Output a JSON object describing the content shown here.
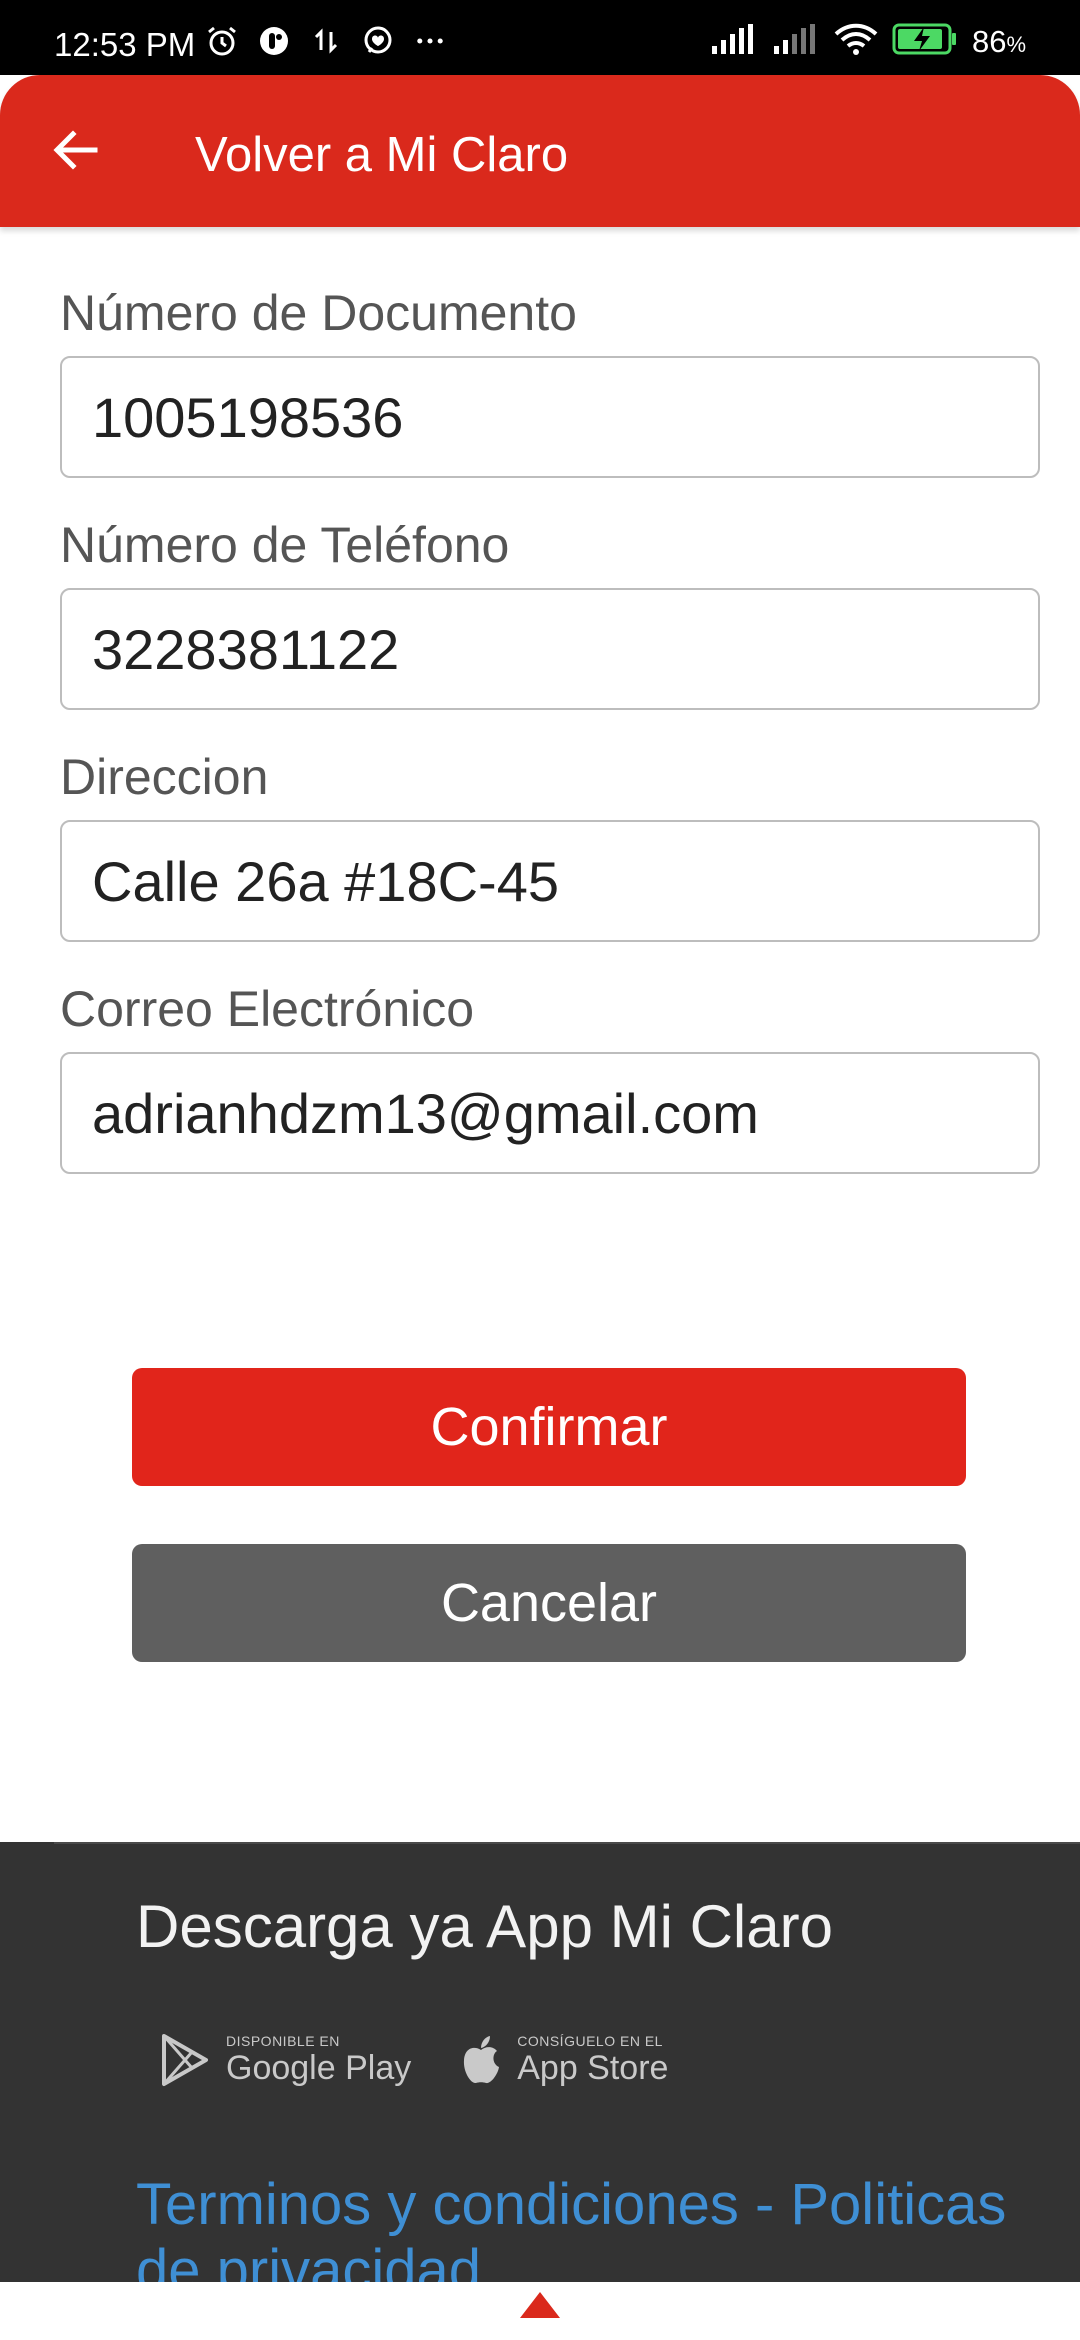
{
  "status_bar": {
    "time": "12:53 PM",
    "battery": "86",
    "battery_unit": "%",
    "icons": [
      "alarm-icon",
      "messenger-icon",
      "data-transfer-icon",
      "chat-icon",
      "more-dots-icon",
      "signal-icon",
      "signal-icon",
      "wifi-icon",
      "battery-charging-icon"
    ]
  },
  "app_bar": {
    "title": "Volver a Mi Claro",
    "back_icon": "arrow-left-icon",
    "color": "#da291c"
  },
  "form": {
    "fields": [
      {
        "label": "Número de Documento",
        "value": "1005198536"
      },
      {
        "label": "Número de Teléfono",
        "value": "3228381122"
      },
      {
        "label": "Direccion",
        "value": "Calle 26a #18C-45"
      },
      {
        "label": "Correo Electrónico",
        "value": "adrianhdzm13@gmail.com"
      }
    ]
  },
  "actions": {
    "confirm_label": "Confirmar",
    "cancel_label": "Cancelar",
    "confirm_color": "#e1251b",
    "cancel_color": "#5f5f5f"
  },
  "footer": {
    "title": "Descarga ya App Mi Claro",
    "google_play_small": "DISPONIBLE EN",
    "google_play_big": "Google Play",
    "app_store_small": "CONSÍGUELO EN EL",
    "app_store_big": "App Store",
    "link": "Terminos y condiciones - Politicas de privacidad"
  }
}
